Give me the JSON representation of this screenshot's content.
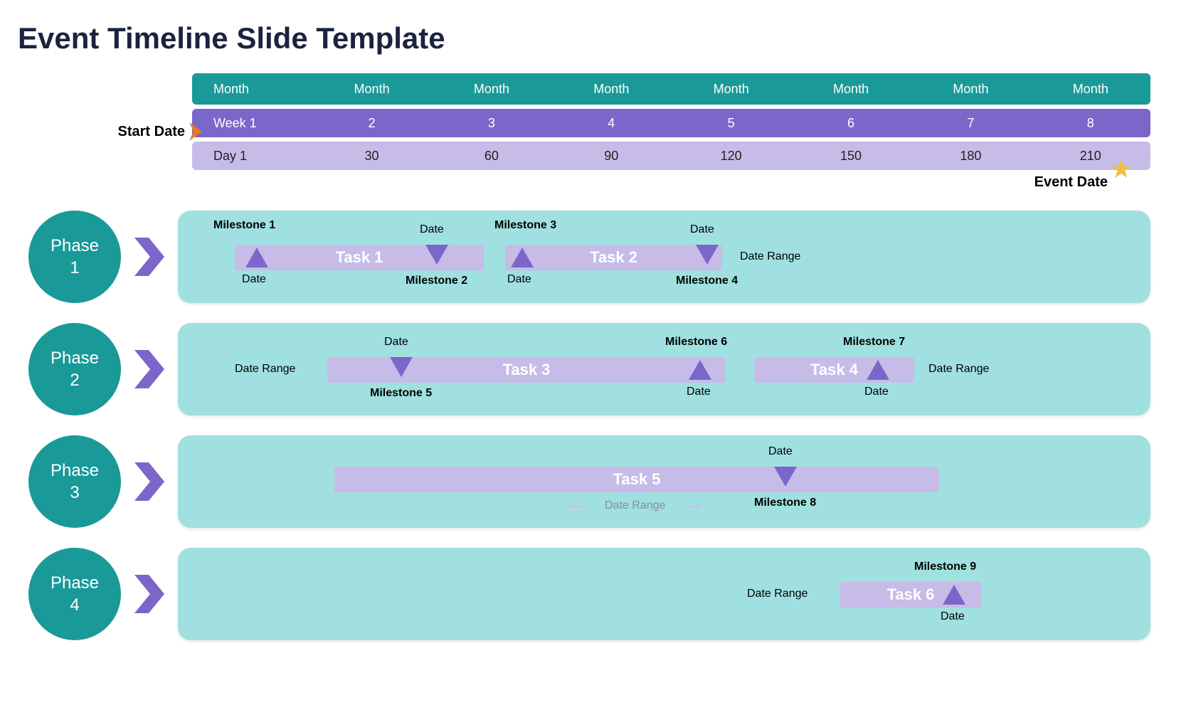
{
  "title": "Event Timeline Slide Template",
  "start_label": "Start Date",
  "event_label": "Event Date",
  "months": [
    "Month",
    "Month",
    "Month",
    "Month",
    "Month",
    "Month",
    "Month",
    "Month"
  ],
  "weeks": [
    "Week 1",
    "2",
    "3",
    "4",
    "5",
    "6",
    "7",
    "8"
  ],
  "days": [
    "Day 1",
    "30",
    "60",
    "90",
    "120",
    "150",
    "180",
    "210"
  ],
  "phases": {
    "p1": "Phase\n1",
    "p2": "Phase\n2",
    "p3": "Phase\n3",
    "p4": "Phase\n4"
  },
  "tasks": {
    "t1": "Task 1",
    "t2": "Task 2",
    "t3": "Task 3",
    "t4": "Task 4",
    "t5": "Task 5",
    "t6": "Task 6"
  },
  "milestones": {
    "m1": "Milestone 1",
    "m2": "Milestone 2",
    "m3": "Milestone 3",
    "m4": "Milestone 4",
    "m5": "Milestone 5",
    "m6": "Milestone 6",
    "m7": "Milestone 7",
    "m8": "Milestone 8",
    "m9": "Milestone 9"
  },
  "labels": {
    "date": "Date",
    "date_range": "Date Range"
  }
}
